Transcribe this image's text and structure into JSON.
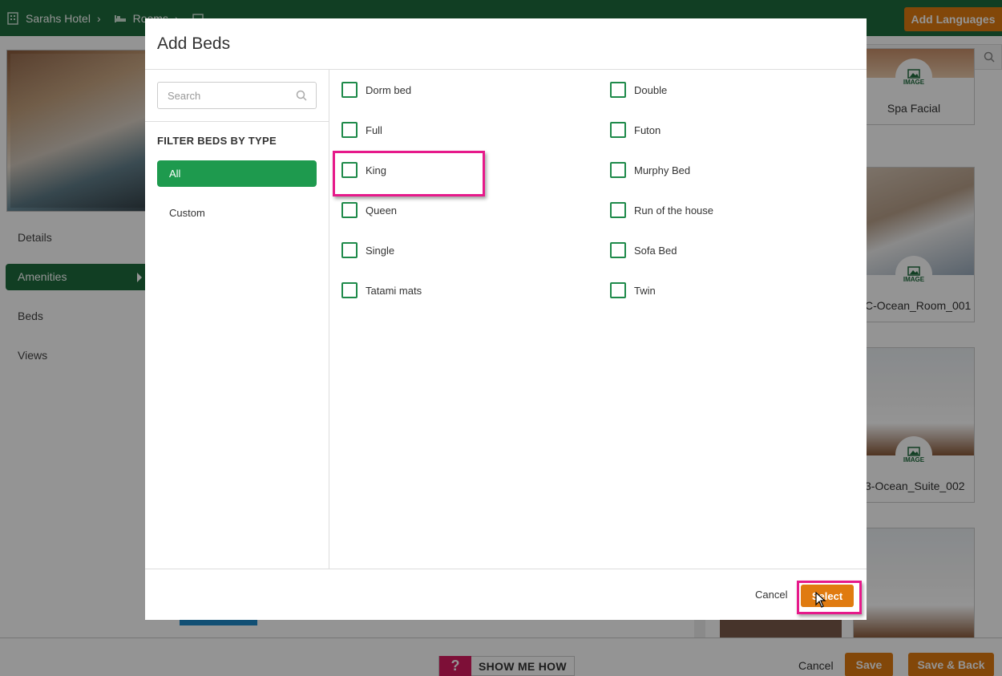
{
  "topbar": {
    "crumbs": [
      "Sarahs Hotel",
      "Rooms"
    ],
    "add_languages": "Add Languages"
  },
  "side_nav": {
    "items": [
      {
        "label": "Details",
        "active": false
      },
      {
        "label": "Amenities",
        "active": true
      },
      {
        "label": "Beds",
        "active": false
      },
      {
        "label": "Views",
        "active": false
      }
    ]
  },
  "cards": [
    {
      "badge": "IMAGE",
      "title": "Spa Facial"
    },
    {
      "badge": "IMAGE",
      "title": "C-Ocean_Room_001"
    },
    {
      "badge": "IMAGE",
      "title": "3-Ocean_Suite_002"
    }
  ],
  "footer": {
    "cancel": "Cancel",
    "save": "Save",
    "save_back": "Save & Back",
    "show_me_q": "?",
    "show_me": "SHOW ME HOW"
  },
  "modal": {
    "title": "Add Beds",
    "search_placeholder": "Search",
    "filter_heading": "FILTER BEDS BY TYPE",
    "filters": [
      {
        "label": "All",
        "active": true
      },
      {
        "label": "Custom",
        "active": false
      }
    ],
    "beds": [
      "Dorm bed",
      "Double",
      "Full",
      "Futon",
      "King",
      "Murphy Bed",
      "Queen",
      "Run of the house",
      "Single",
      "Sofa Bed",
      "Tatami mats",
      "Twin"
    ],
    "cancel": "Cancel",
    "select": "Select"
  },
  "colors": {
    "brand_green": "#1e6b3d",
    "filter_green": "#1e9a4e",
    "accent_orange": "#e07b10",
    "highlight_pink": "#e6198a"
  }
}
